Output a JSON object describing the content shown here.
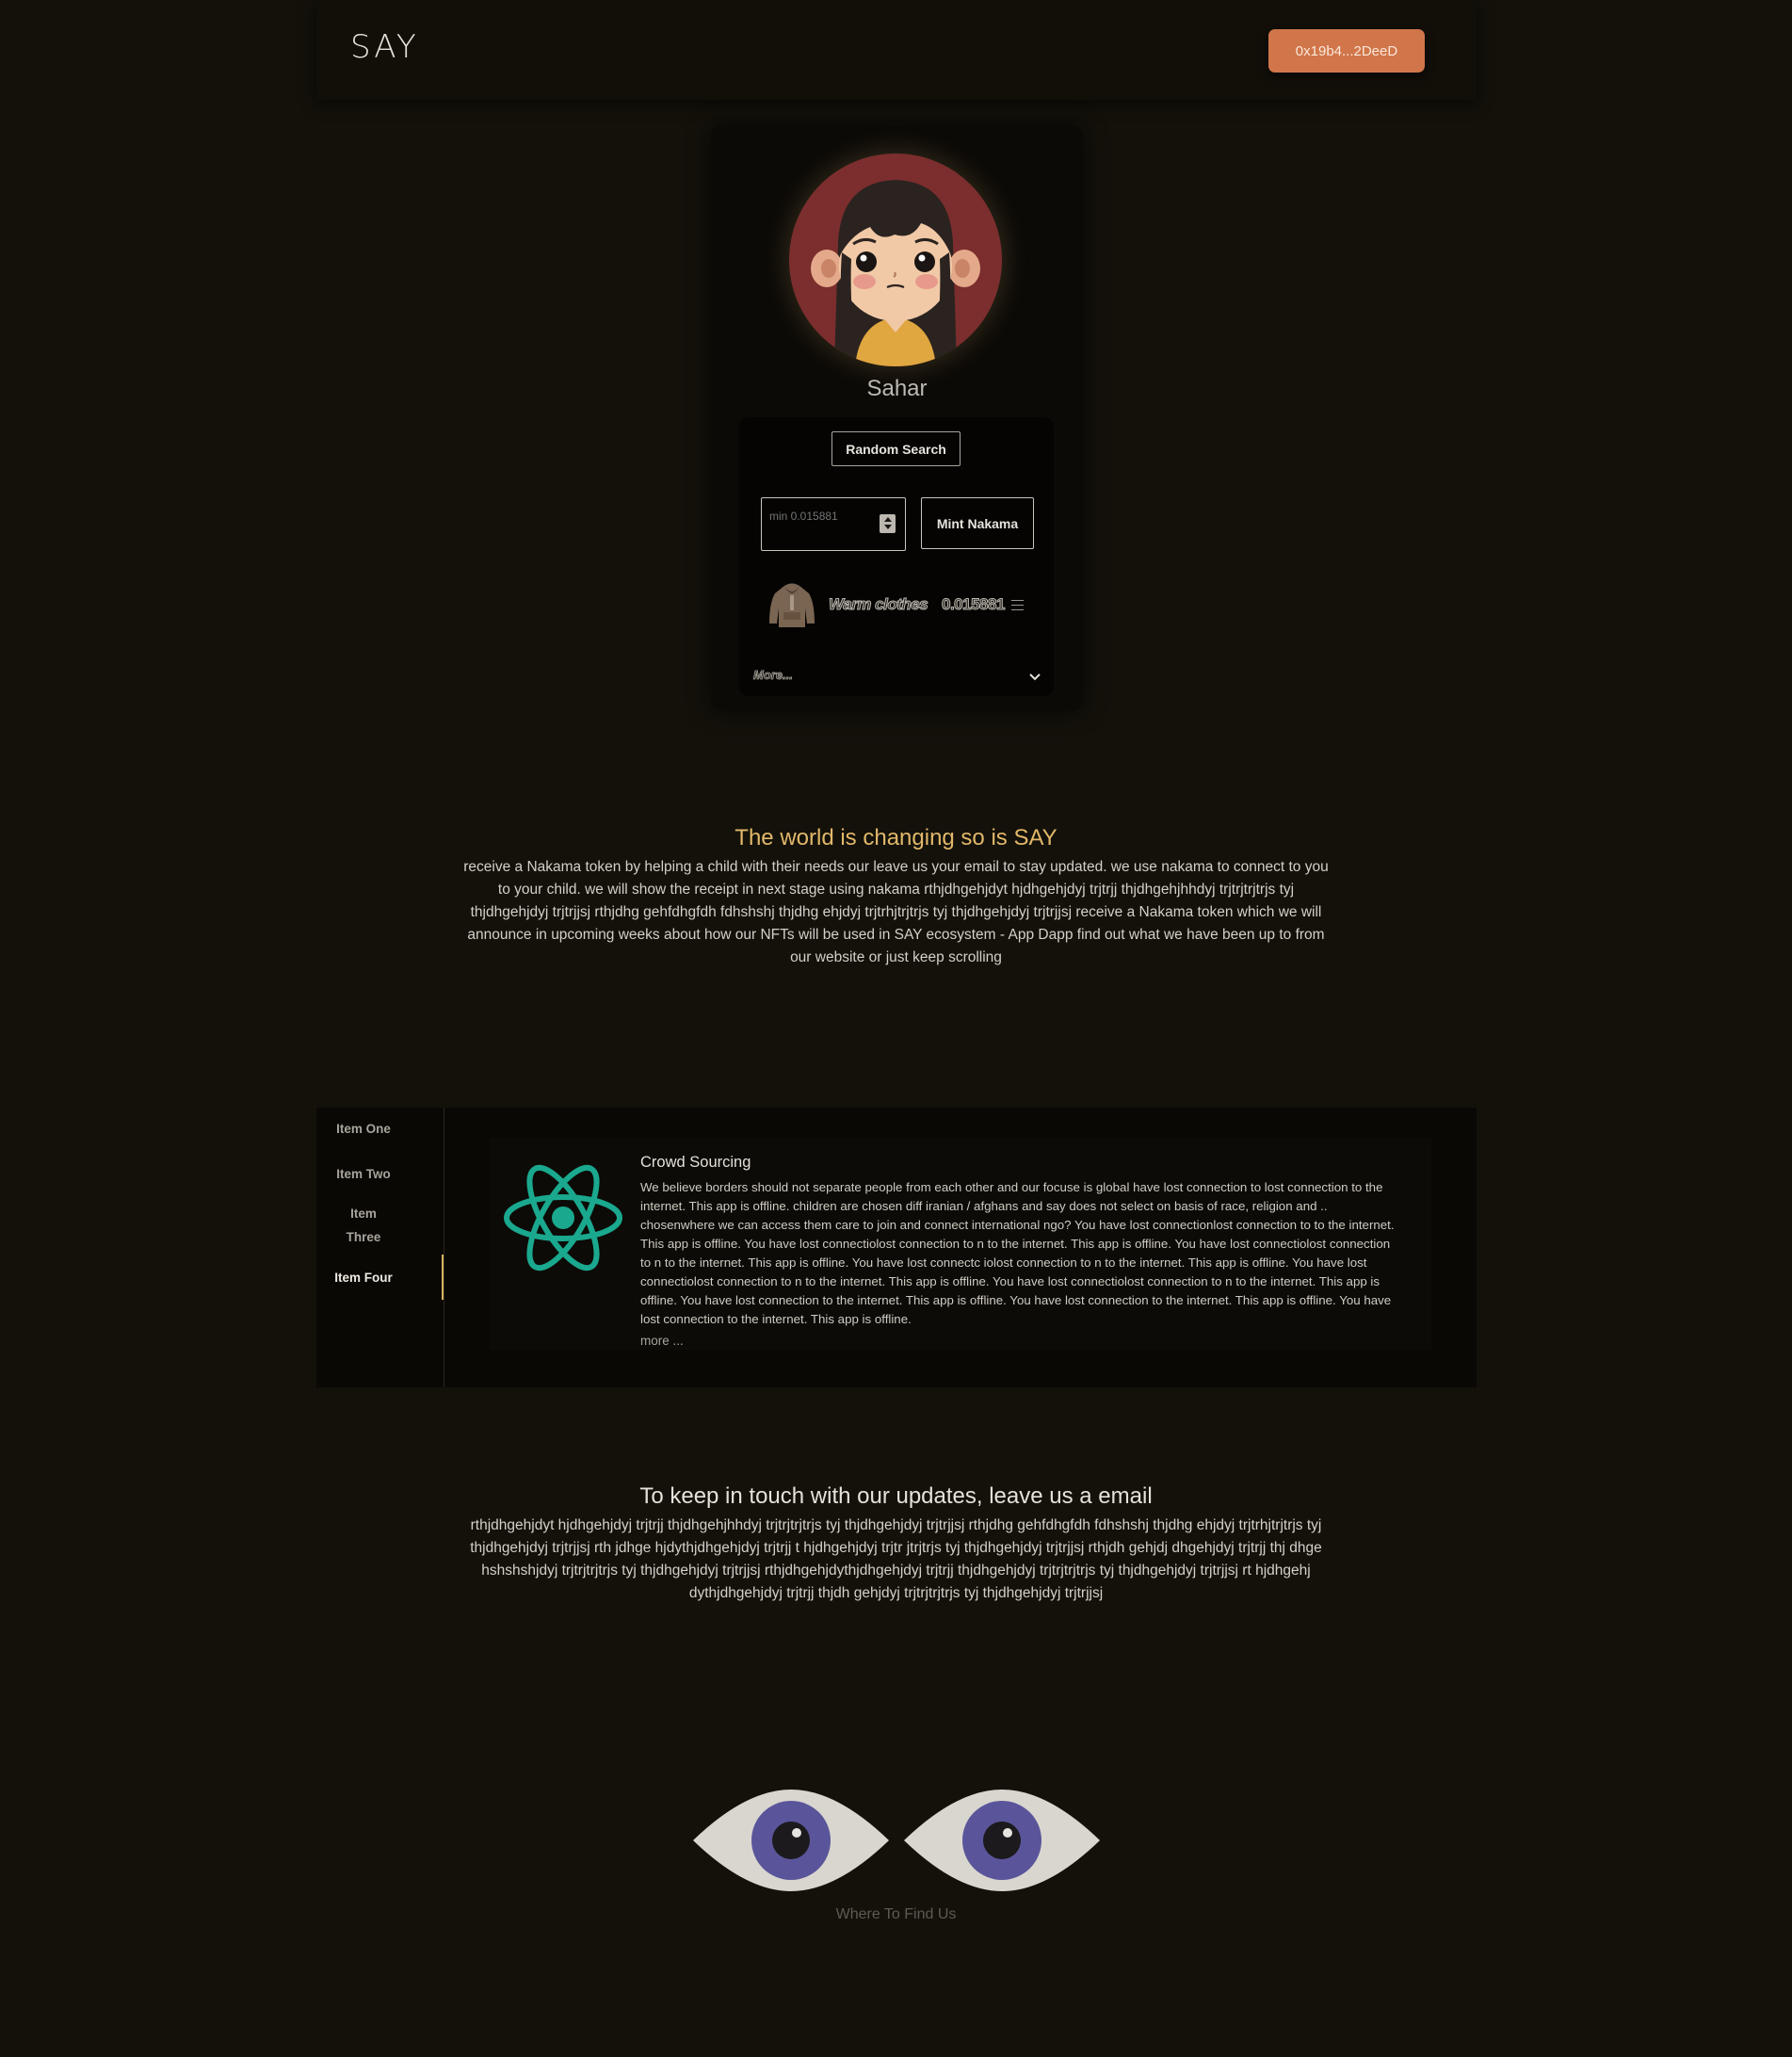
{
  "header": {
    "logo": "SAY",
    "wallet_address": "0x19b4...2DeeD"
  },
  "child": {
    "name": "Sahar",
    "random_search_label": "Random Search",
    "amount_placeholder": "min 0.015881",
    "mint_label": "Mint Nakama",
    "need": {
      "name": "Warm clothes",
      "cost": "0.015881",
      "icon": "hoodie-icon"
    },
    "more_label": "More..."
  },
  "about": {
    "title": "The world is changing so is SAY",
    "body": "receive a Nakama token by helping a child with their needs our leave us your email to stay updated. we use nakama to connect to you to your child. we will show the receipt in next stage using nakama rthjdhgehjdyt hjdhgehjdyj trjtrjj thjdhgehjhhdyj trjtrjtrjtrjs tyj thjdhgehjdyj trjtrjjsj rthjdhg gehfdhgfdh fdhshshj thjdhg ehjdyj trjtrhjtrjtrjs tyj thjdhgehjdyj trjtrjjsj receive a Nakama token which we will announce in upcoming weeks about how our NFTs will be used in SAY ecosystem - App Dapp find out what we have been up to from our website or just keep scrolling"
  },
  "tabs": {
    "items": [
      "Item One",
      "Item Two",
      "Item Three",
      "Item Four"
    ],
    "active_index": 3,
    "panel": {
      "icon": "react-icon",
      "title": "Crowd Sourcing",
      "body": "We believe borders should not separate people from each other and our focuse is global have lost connection to lost connection to the internet. This app is offline. children are chosen diff iranian / afghans and say does not select on basis of race, religion and .. chosenwhere we can access them care to join and connect international ngo? You have lost connectionlost connection to to the internet. This app is offline. You have lost connectiolost connection to n to the internet. This app is offline. You have lost connectiolost connection to n to the internet. This app is offline. You have lost connectc iolost connection to n to the internet. This app is offline. You have lost connectiolost connection to n to the internet. This app is offline. You have lost connectiolost connection to n to the internet. This app is offline. You have lost connection to the internet. This app is offline. You have lost connection to the internet. This app is offline. You have lost connection to the internet. This app is offline.",
      "more_label": "more ..."
    }
  },
  "email": {
    "title": "To keep in touch with our updates, leave us a email",
    "body": "rthjdhgehjdyt hjdhgehjdyj trjtrjj thjdhgehjhhdyj trjtrjtrjtrjs tyj thjdhgehjdyj trjtrjjsj rthjdhg gehfdhgfdh fdhshshj thjdhg ehjdyj trjtrhjtrjtrjs tyj thjdhgehjdyj trjtrjjsj rth jdhge hjdythjdhgehjdyj trjtrjj t hjdhgehjdyj trjtr jtrjtrjs tyj thjdhgehjdyj trjtrjjsj rthjdh gehjdj dhgehjdyj trjtrjj thj dhge hshshshjdyj trjtrjtrjtrjs tyj thjdhgehjdyj trjtrjjsj rthjdhgehjdythjdhgehjdyj trjtrjj thjdhgehjdyj trjtrjtrjtrjs tyj thjdhgehjdyj trjtrjjsj rt hjdhgehj dythjdhgehjdyj trjtrjj thjdh gehjdyj trjtrjtrjtrjs tyj thjdhgehjdyj trjtrjjsj"
  },
  "footer": {
    "find_us": "Where To Find Us",
    "icon": "eyes-icon"
  },
  "colors": {
    "background": "#13110a",
    "accent_orange": "#d0764a",
    "accent_gold": "#e2b86a",
    "react_teal": "#1aa88e",
    "eye_iris": "#5a559a"
  }
}
